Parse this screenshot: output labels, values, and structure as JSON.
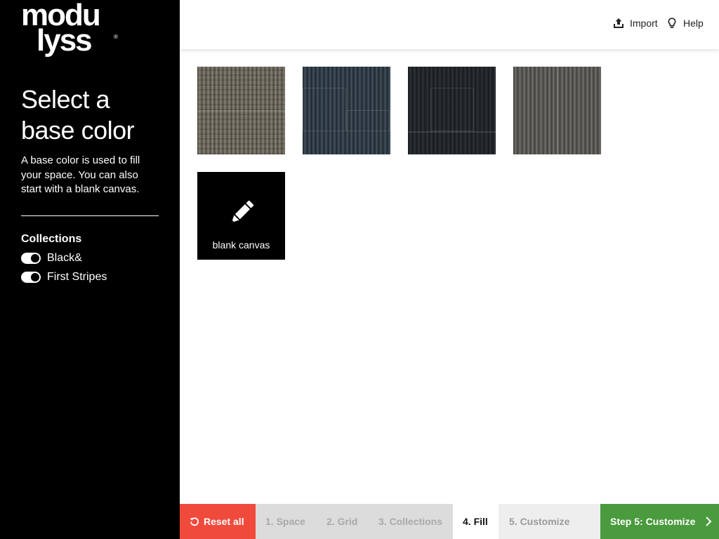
{
  "brand": {
    "logo_line1": "modu",
    "logo_line2": "lyss",
    "logo_mark": "®"
  },
  "sidebar": {
    "title": "Select a base color",
    "description": "A base color is used to fill your space. You can also start with a blank canvas.",
    "collections_heading": "Collections",
    "collections": [
      {
        "label": "Black&",
        "enabled": true
      },
      {
        "label": "First Stripes",
        "enabled": true
      }
    ]
  },
  "header": {
    "import_label": "Import",
    "help_label": "Help",
    "import_icon": "upload-icon",
    "help_icon": "lightbulb-icon"
  },
  "tiles": {
    "blank_label": "blank canvas",
    "blank_icon": "pencil-icon"
  },
  "footer": {
    "reset_label": "Reset all",
    "reset_icon": "reset-icon",
    "steps": [
      {
        "label": "1. Space",
        "state": "done"
      },
      {
        "label": "2. Grid",
        "state": "done"
      },
      {
        "label": "3. Collections",
        "state": "done"
      },
      {
        "label": "4. Fill",
        "state": "current"
      },
      {
        "label": "5. Customize",
        "state": "upcoming"
      }
    ],
    "next_label": "Step 5: Customize",
    "next_icon": "chevron-right-icon"
  },
  "colors": {
    "sidebar_bg": "#000000",
    "reset_red": "#f04a3c",
    "next_green": "#4a9a3e",
    "past_step_bg": "#dcdcdc",
    "future_step_bg": "#eeeeee"
  }
}
